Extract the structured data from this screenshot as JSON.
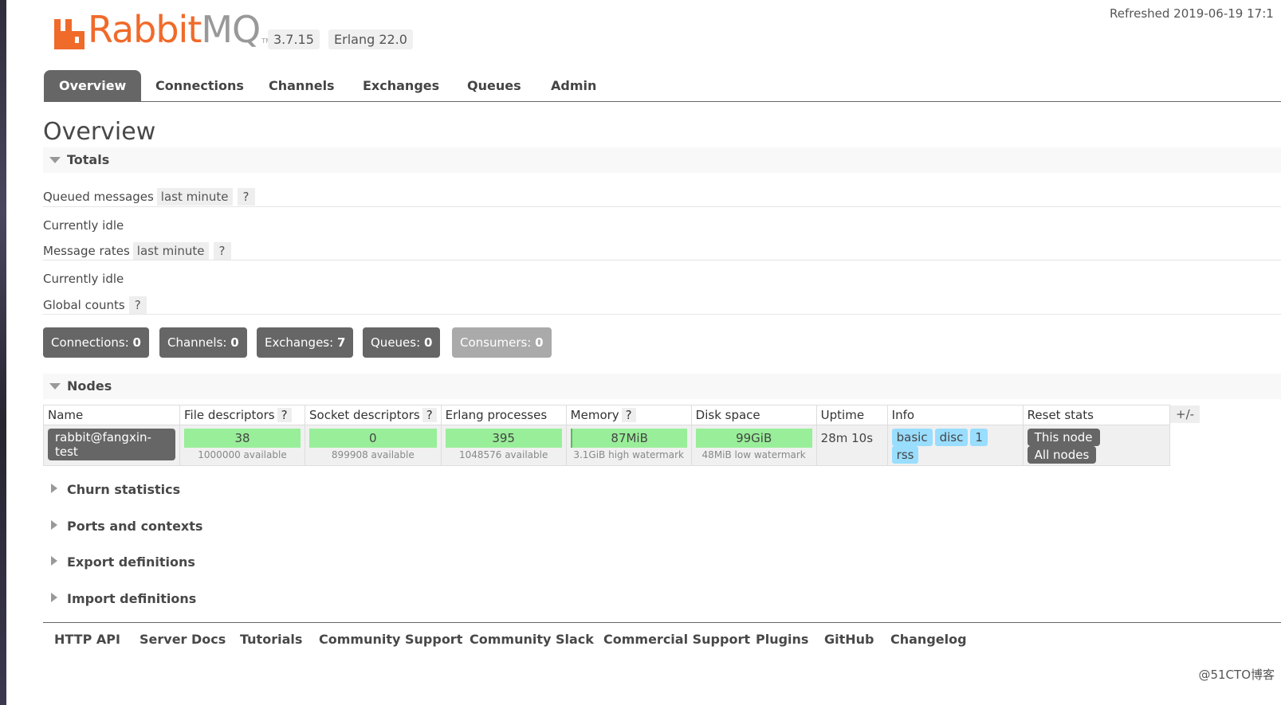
{
  "app": {
    "logo_main": "Rabbit",
    "logo_mq": "MQ",
    "logo_tm": "TM",
    "version": "3.7.15",
    "erlang": "Erlang 22.0",
    "refreshed": "Refreshed 2019-06-19 17:1",
    "brand_color": "#f06a2a"
  },
  "tabs": [
    "Overview",
    "Connections",
    "Channels",
    "Exchanges",
    "Queues",
    "Admin"
  ],
  "page_title": "Overview",
  "totals": {
    "heading": "Totals",
    "queued_messages_label": "Queued messages",
    "queued_messages_range": "last minute",
    "help": "?",
    "queued_status": "Currently idle",
    "message_rates_label": "Message rates",
    "message_rates_range": "last minute",
    "rates_status": "Currently idle",
    "global_counts_label": "Global counts"
  },
  "counts": [
    {
      "label": "Connections:",
      "value": "0"
    },
    {
      "label": "Channels:",
      "value": "0"
    },
    {
      "label": "Exchanges:",
      "value": "7"
    },
    {
      "label": "Queues:",
      "value": "0"
    },
    {
      "label": "Consumers:",
      "value": "0"
    }
  ],
  "nodes": {
    "heading": "Nodes",
    "columns": [
      "Name",
      "File descriptors",
      "Socket descriptors",
      "Erlang processes",
      "Memory",
      "Disk space",
      "Uptime",
      "Info",
      "Reset stats"
    ],
    "plus_minus": "+/-",
    "row": {
      "name": "rabbit@fangxin-test",
      "file_descriptors": "38",
      "file_descriptors_sub": "1000000 available",
      "socket_descriptors": "0",
      "socket_descriptors_sub": "899908 available",
      "erlang_processes": "395",
      "erlang_processes_sub": "1048576 available",
      "memory": "87MiB",
      "memory_sub": "3.1GiB high watermark",
      "disk_space": "99GiB",
      "disk_space_sub": "48MiB low watermark",
      "uptime": "28m 10s",
      "info": [
        "basic",
        "disc",
        "1",
        "rss"
      ],
      "reset": [
        "This node",
        "All nodes"
      ]
    }
  },
  "collapsed_sections": [
    "Churn statistics",
    "Ports and contexts",
    "Export definitions",
    "Import definitions"
  ],
  "footer": [
    "HTTP API",
    "Server Docs",
    "Tutorials",
    "Community Support",
    "Community Slack",
    "Commercial Support",
    "Plugins",
    "GitHub",
    "Changelog"
  ],
  "watermark": "@51CTO博客"
}
